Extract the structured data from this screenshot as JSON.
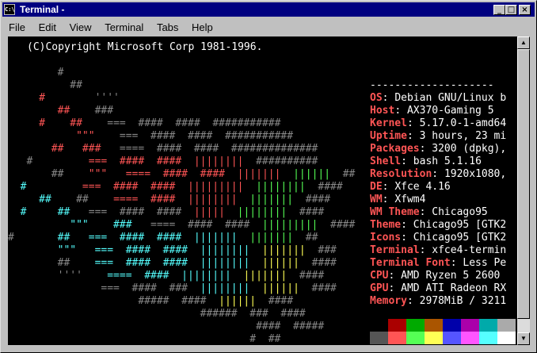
{
  "window": {
    "title": "Terminal -"
  },
  "menu": [
    "File",
    "Edit",
    "View",
    "Terminal",
    "Tabs",
    "Help"
  ],
  "copyright": "(C)Copyright Microsoft Corp 1981-1996.",
  "logo_lines": [
    [
      [
        "        #",
        "#888888"
      ]
    ],
    [
      [
        "          ##",
        "#888888"
      ]
    ],
    [
      [
        "     #",
        "#ff5555"
      ],
      [
        "        ''''",
        "#888888"
      ]
    ],
    [
      [
        "        ##",
        "#ff5555"
      ],
      [
        "    ###",
        "#888888"
      ]
    ],
    [
      [
        "     #",
        "#ff5555"
      ],
      [
        "    ##",
        "#ff5555"
      ],
      [
        "    ===",
        "#888888"
      ],
      [
        "  ####",
        "#888888"
      ],
      [
        "  ####",
        "#888888"
      ],
      [
        "  ###########",
        "#888888"
      ]
    ],
    [
      [
        "           \"\"\"",
        "#ff5555"
      ],
      [
        "    ===",
        "#888888"
      ],
      [
        "  ####",
        "#888888"
      ],
      [
        "  ####",
        "#888888"
      ],
      [
        "  ###########",
        "#888888"
      ]
    ],
    [
      [
        "       ##",
        "#ff5555"
      ],
      [
        "   ###",
        "#ff5555"
      ],
      [
        "   ====",
        "#888888"
      ],
      [
        "  ####",
        "#888888"
      ],
      [
        "  ####",
        "#888888"
      ],
      [
        "  ##############",
        "#888888"
      ]
    ],
    [
      [
        "   #",
        "#888888"
      ],
      [
        "         ===",
        "#ff5555"
      ],
      [
        "  ####",
        "#ff5555"
      ],
      [
        "  ####",
        "#ff5555"
      ],
      [
        "  ||||||||",
        "#ff5555"
      ],
      [
        "  ##########",
        "#888888"
      ]
    ],
    [
      [
        "       ##",
        "#888888"
      ],
      [
        "    \"\"\"",
        "#ff5555"
      ],
      [
        "   ====",
        "#ff5555"
      ],
      [
        "  ####",
        "#ff5555"
      ],
      [
        "  ####",
        "#ff5555"
      ],
      [
        "  |||||||",
        "#ff5555"
      ],
      [
        "  ||||||",
        "#55ff55"
      ],
      [
        "  ##",
        "#888888"
      ]
    ],
    [
      [
        "  #",
        "#55ffff"
      ],
      [
        "         ===",
        "#ff5555"
      ],
      [
        "  ####",
        "#ff5555"
      ],
      [
        "  ####",
        "#ff5555"
      ],
      [
        "  |||||||||",
        "#ff5555"
      ],
      [
        "  ||||||||",
        "#55ff55"
      ],
      [
        "  ####",
        "#888888"
      ]
    ],
    [
      [
        "     ##",
        "#55ffff"
      ],
      [
        "    ##",
        "#888888"
      ],
      [
        "    ====",
        "#ff5555"
      ],
      [
        "  ####",
        "#ff5555"
      ],
      [
        "  ||||||||",
        "#ff5555"
      ],
      [
        "  |||||||",
        "#55ff55"
      ],
      [
        "  ####",
        "#888888"
      ]
    ],
    [
      [
        "  #",
        "#55ffff"
      ],
      [
        "     ##",
        "#55ffff"
      ],
      [
        "   ===",
        "#888888"
      ],
      [
        "  ####",
        "#888888"
      ],
      [
        "  ####",
        "#888888"
      ],
      [
        "  |||||",
        "#ff5555"
      ],
      [
        "  ||||||||",
        "#55ff55"
      ],
      [
        "  ####",
        "#888888"
      ]
    ],
    [
      [
        "          \"\"\"",
        "#55ffff"
      ],
      [
        "    ###",
        "#55ffff"
      ],
      [
        "   ====",
        "#888888"
      ],
      [
        "  ####",
        "#888888"
      ],
      [
        "  ####",
        "#888888"
      ],
      [
        "  |||||||||",
        "#55ff55"
      ],
      [
        "  ####",
        "#888888"
      ]
    ],
    [
      [
        "#",
        "#888888"
      ],
      [
        "       ##",
        "#55ffff"
      ],
      [
        "   ===",
        "#55ffff"
      ],
      [
        "  ####",
        "#55ffff"
      ],
      [
        "  ####",
        "#55ffff"
      ],
      [
        "  |||||||",
        "#55ffff"
      ],
      [
        "  |||||||",
        "#55ff55"
      ],
      [
        "  ##",
        "#888888"
      ]
    ],
    [
      [
        "        \"\"\"",
        "#55ffff"
      ],
      [
        "   ===",
        "#55ffff"
      ],
      [
        "  ####",
        "#55ffff"
      ],
      [
        "  ####",
        "#55ffff"
      ],
      [
        "  ||||||||",
        "#55ffff"
      ],
      [
        "  |||||||",
        "#ffff55"
      ],
      [
        "  ###",
        "#888888"
      ]
    ],
    [
      [
        "        ##",
        "#888888"
      ],
      [
        "    ===",
        "#55ffff"
      ],
      [
        "  ####",
        "#55ffff"
      ],
      [
        "  ####",
        "#55ffff"
      ],
      [
        "  ||||||||",
        "#55ffff"
      ],
      [
        "  ||||||",
        "#ffff55"
      ],
      [
        "  ####",
        "#888888"
      ]
    ],
    [
      [
        "        ''''",
        "#888888"
      ],
      [
        "    ====",
        "#55ffff"
      ],
      [
        "  ####",
        "#55ffff"
      ],
      [
        "  ||||||||",
        "#55ffff"
      ],
      [
        "  |||||||",
        "#ffff55"
      ],
      [
        "  ####",
        "#888888"
      ]
    ],
    [
      [
        "               ===",
        "#888888"
      ],
      [
        "  ####",
        "#888888"
      ],
      [
        "  ###",
        "#888888"
      ],
      [
        "  ||||||||",
        "#55ffff"
      ],
      [
        "  ||||||",
        "#ffff55"
      ],
      [
        "  ####",
        "#888888"
      ]
    ],
    [
      [
        "                     #####",
        "#888888"
      ],
      [
        "  ####",
        "#888888"
      ],
      [
        "  ||||||",
        "#ffff55"
      ],
      [
        "  ####",
        "#888888"
      ]
    ],
    [
      [
        "                               ######",
        "#888888"
      ],
      [
        "  ###",
        "#888888"
      ],
      [
        "  ####",
        "#888888"
      ]
    ],
    [
      [
        "                                        ####",
        "#888888"
      ],
      [
        "  #####",
        "#888888"
      ]
    ],
    [
      [
        "                                       #",
        "#888888"
      ],
      [
        "  ##",
        "#888888"
      ]
    ]
  ],
  "info": {
    "rule": "--------------------",
    "rows": [
      {
        "label": "OS",
        "value": "Debian GNU/Linux b"
      },
      {
        "label": "Host",
        "value": "AX370-Gaming 5"
      },
      {
        "label": "Kernel",
        "value": "5.17.0-1-amd64"
      },
      {
        "label": "Uptime",
        "value": "3 hours, 23 mi"
      },
      {
        "label": "Packages",
        "value": "3200 (dpkg),"
      },
      {
        "label": "Shell",
        "value": "bash 5.1.16"
      },
      {
        "label": "Resolution",
        "value": "1920x1080,"
      },
      {
        "label": "DE",
        "value": "Xfce 4.16"
      },
      {
        "label": "WM",
        "value": "Xfwm4"
      },
      {
        "label": "WM Theme",
        "value": "Chicago95"
      },
      {
        "label": "Theme",
        "value": "Chicago95 [GTK2"
      },
      {
        "label": "Icons",
        "value": "Chicago95 [GTK2"
      },
      {
        "label": "Terminal",
        "value": "xfce4-termin"
      },
      {
        "label": "Terminal Font",
        "value": "Less Pe"
      },
      {
        "label": "CPU",
        "value": "AMD Ryzen 5 2600"
      },
      {
        "label": "GPU",
        "value": "AMD ATI Radeon RX"
      },
      {
        "label": "Memory",
        "value": "2978MiB / 3211"
      }
    ],
    "palette_dark": [
      "#000000",
      "#aa0000",
      "#00aa00",
      "#aa5500",
      "#0000aa",
      "#aa00aa",
      "#00aaaa",
      "#aaaaaa"
    ],
    "palette_bright": [
      "#555555",
      "#ff5555",
      "#55ff55",
      "#ffff55",
      "#5555ff",
      "#ff55ff",
      "#55ffff",
      "#ffffff"
    ]
  }
}
